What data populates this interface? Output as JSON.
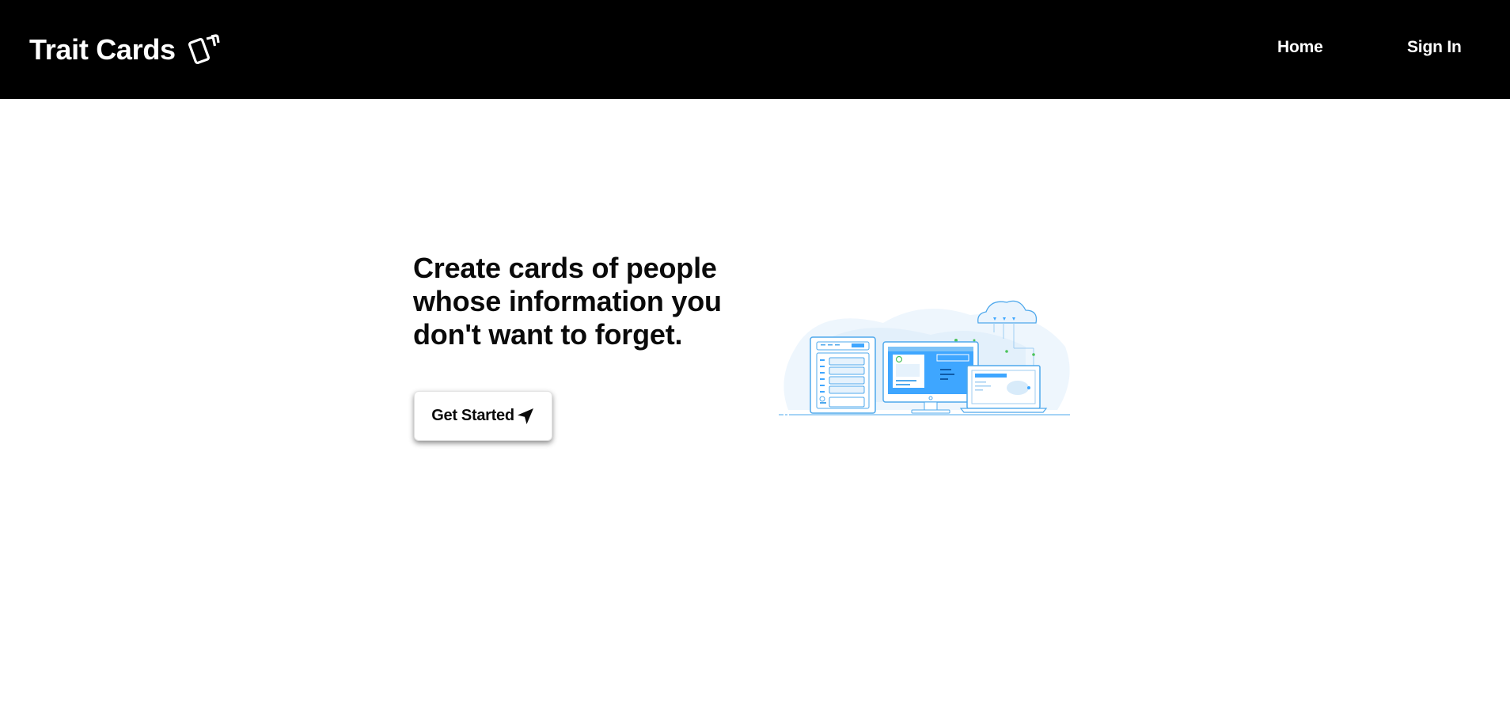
{
  "navbar": {
    "brand_label": "Trait Cards",
    "brand_icon": "cards-icon",
    "links": [
      {
        "label": "Home"
      },
      {
        "label": "Sign In"
      }
    ],
    "background": "#000000",
    "text_color": "#ffffff"
  },
  "hero": {
    "headline": "Create cards of people whose information you don't want to forget.",
    "cta_label": "Get Started",
    "cta_icon": "location-arrow-icon",
    "illustration": "cloud-devices-illustration",
    "illustration_accent": "#3ea6ff"
  }
}
